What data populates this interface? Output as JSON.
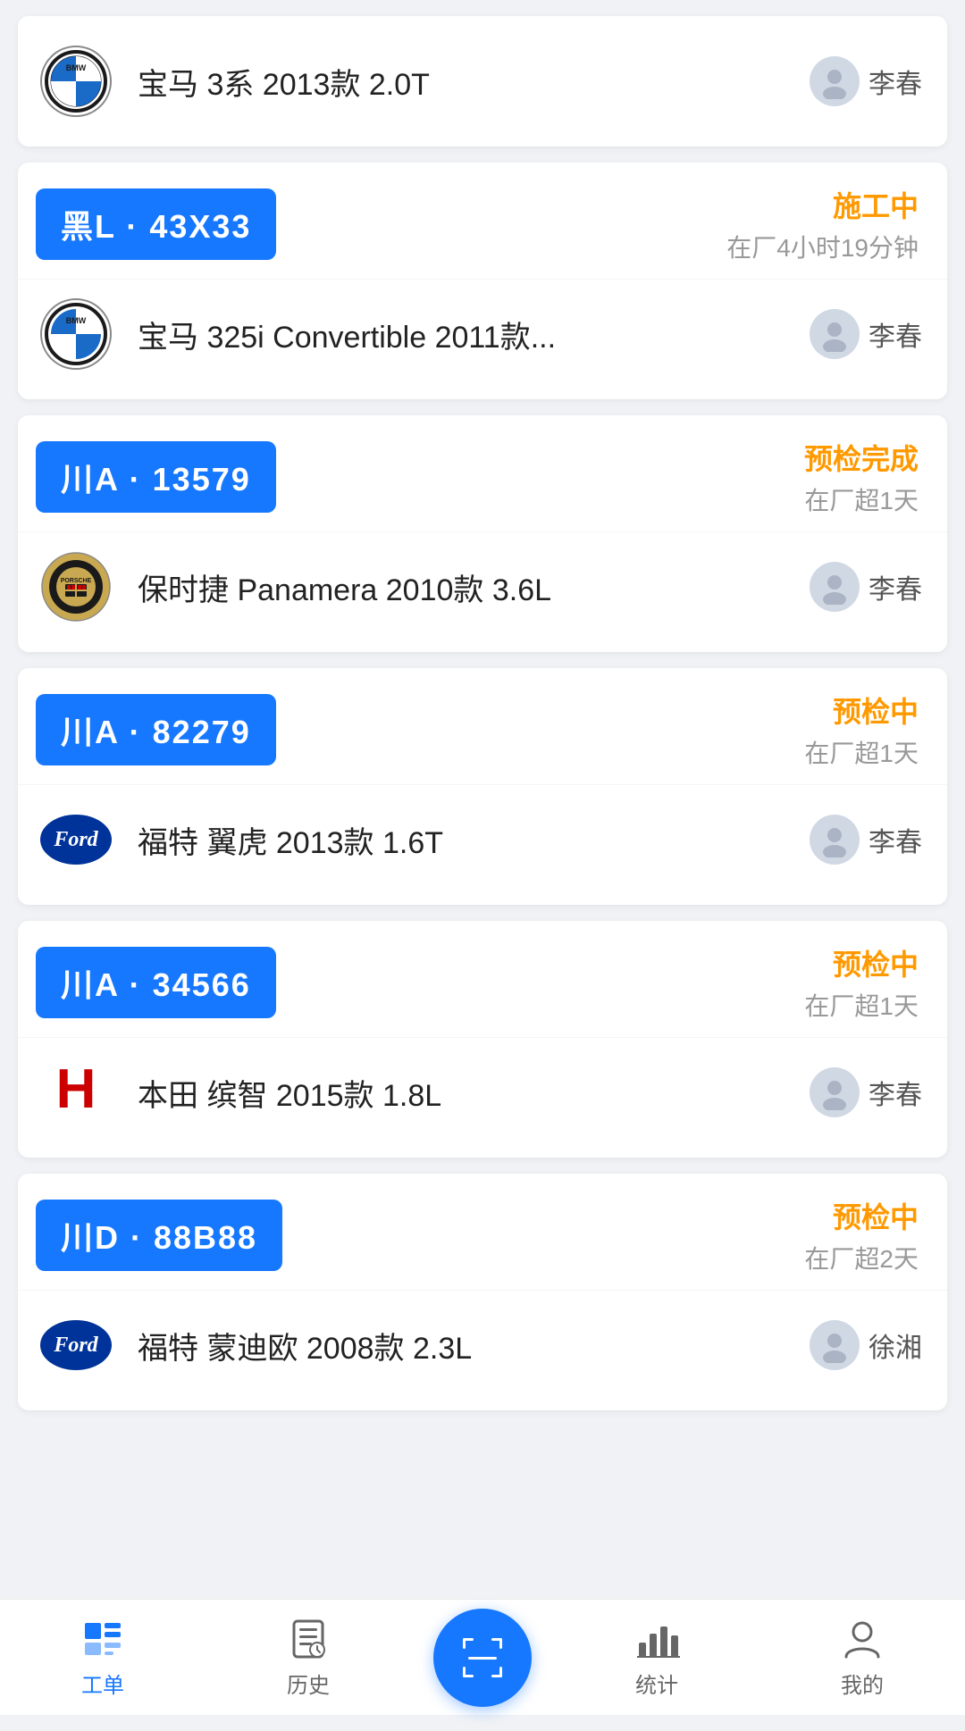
{
  "cards": [
    {
      "id": "card-0",
      "plate": null,
      "status": null,
      "time": null,
      "logo": "bmw",
      "carName": "宝马 3系 2013款 2.0T",
      "tech": "李春"
    },
    {
      "id": "card-1",
      "plate": "黑L · 43X33",
      "status": "施工中",
      "time": "在厂4小时19分钟",
      "logo": "bmw",
      "carName": "宝马 325i Convertible 2011款...",
      "tech": "李春"
    },
    {
      "id": "card-2",
      "plate": "川A · 13579",
      "status": "预检完成",
      "time": "在厂超1天",
      "logo": "porsche",
      "carName": "保时捷 Panamera 2010款 3.6L",
      "tech": "李春"
    },
    {
      "id": "card-3",
      "plate": "川A · 82279",
      "status": "预检中",
      "time": "在厂超1天",
      "logo": "ford",
      "carName": "福特 翼虎 2013款 1.6T",
      "tech": "李春"
    },
    {
      "id": "card-4",
      "plate": "川A · 34566",
      "status": "预检中",
      "time": "在厂超1天",
      "logo": "honda",
      "carName": "本田 缤智 2015款 1.8L",
      "tech": "李春"
    },
    {
      "id": "card-5",
      "plate": "川D · 88B88",
      "status": "预检中",
      "time": "在厂超2天",
      "logo": "ford",
      "carName": "福特 蒙迪欧 2008款 2.3L",
      "tech": "徐湘"
    }
  ],
  "nav": {
    "items": [
      {
        "id": "workorder",
        "label": "工单",
        "active": true
      },
      {
        "id": "history",
        "label": "历史",
        "active": false
      },
      {
        "id": "scan",
        "label": "",
        "active": false,
        "center": true
      },
      {
        "id": "stats",
        "label": "统计",
        "active": false
      },
      {
        "id": "mine",
        "label": "我的",
        "active": false
      }
    ]
  }
}
